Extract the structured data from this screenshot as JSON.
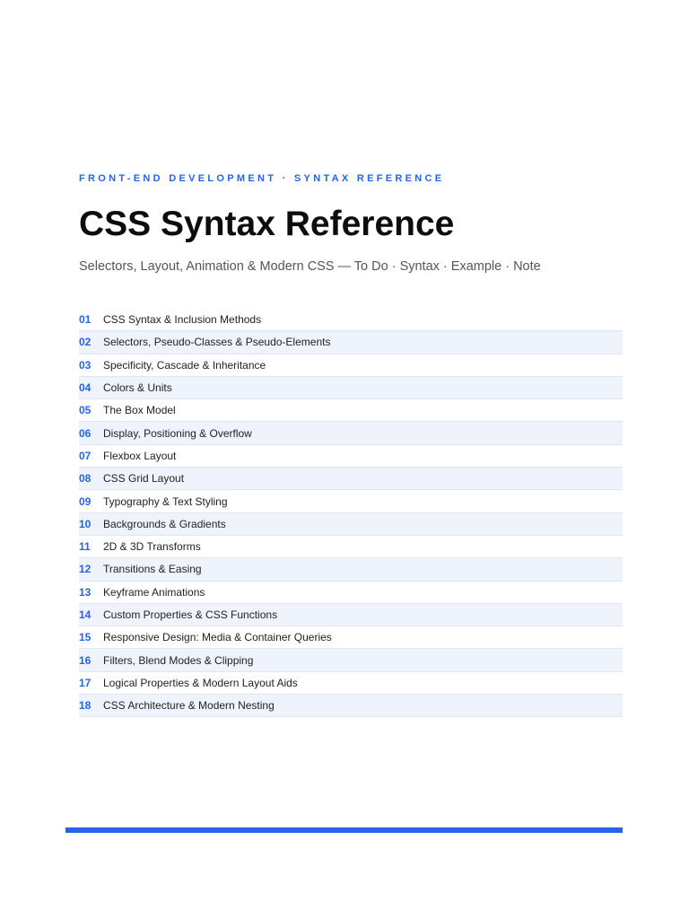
{
  "header": {
    "kicker": "FRONT-END DEVELOPMENT · SYNTAX REFERENCE",
    "title": "CSS Syntax Reference",
    "subtitle": "Selectors, Layout, Animation & Modern CSS — To Do · Syntax · Example · Note"
  },
  "toc": [
    {
      "num": "01",
      "label": "CSS Syntax & Inclusion Methods"
    },
    {
      "num": "02",
      "label": "Selectors, Pseudo-Classes & Pseudo-Elements"
    },
    {
      "num": "03",
      "label": "Specificity, Cascade & Inheritance"
    },
    {
      "num": "04",
      "label": "Colors & Units"
    },
    {
      "num": "05",
      "label": "The Box Model"
    },
    {
      "num": "06",
      "label": "Display, Positioning & Overflow"
    },
    {
      "num": "07",
      "label": "Flexbox Layout"
    },
    {
      "num": "08",
      "label": "CSS Grid Layout"
    },
    {
      "num": "09",
      "label": "Typography & Text Styling"
    },
    {
      "num": "10",
      "label": "Backgrounds & Gradients"
    },
    {
      "num": "11",
      "label": "2D & 3D Transforms"
    },
    {
      "num": "12",
      "label": "Transitions & Easing"
    },
    {
      "num": "13",
      "label": "Keyframe Animations"
    },
    {
      "num": "14",
      "label": "Custom Properties & CSS Functions"
    },
    {
      "num": "15",
      "label": "Responsive Design: Media & Container Queries"
    },
    {
      "num": "16",
      "label": "Filters, Blend Modes & Clipping"
    },
    {
      "num": "17",
      "label": "Logical Properties & Modern Layout Aids"
    },
    {
      "num": "18",
      "label": "CSS Architecture & Modern Nesting"
    }
  ],
  "colors": {
    "accent": "#2563eb",
    "row_alt": "#eef3fc",
    "divider": "#dfe6f0"
  }
}
